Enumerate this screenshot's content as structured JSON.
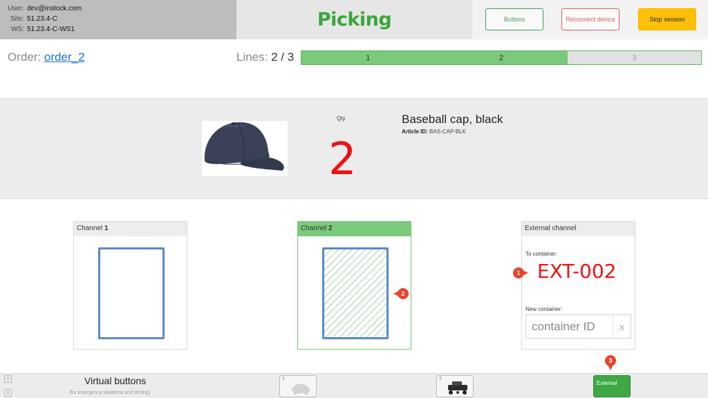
{
  "header": {
    "user_label": "User:",
    "user_value": "dev@instock.com",
    "site_label": "Site:",
    "site_value": "51.23.4-C",
    "ws_label": "WS:",
    "ws_value": "51.23.4-C-WS1",
    "title": "Picking",
    "buttons_label": "Buttons",
    "reconnect_label": "Reconnect device",
    "stop_label": "Stop session"
  },
  "order": {
    "label": "Order:",
    "value": "order_2"
  },
  "lines": {
    "label": "Lines:",
    "count": "2 / 3",
    "segments": [
      {
        "label": "1",
        "state": "done"
      },
      {
        "label": "2",
        "state": "done"
      },
      {
        "label": "3",
        "state": "todo"
      }
    ]
  },
  "article": {
    "image_icon": "baseball-cap-image",
    "qty_label": "Qty",
    "qty_value": "2",
    "name": "Baseball cap, black",
    "id_label": "Article ID:",
    "id_value": "BAS-CAP-BLK"
  },
  "channels": {
    "ch1_label": "Channel",
    "ch1_num": "1",
    "ch2_label": "Channel",
    "ch2_num": "2",
    "ext_label": "External channel",
    "to_container_label": "To container:",
    "to_container_value": "EXT-002",
    "new_container_label": "New container:",
    "new_container_placeholder": "container ID",
    "clear_label": "x",
    "pin1": "1",
    "pin2": "2",
    "pin3": "3"
  },
  "bottom": {
    "title": "Virtual buttons",
    "subtitle": "(for emergency situations and testing)",
    "box_a": "0",
    "box_b": "0",
    "btn1_num": "1",
    "btn2_num": "2",
    "ext_button_label": "External"
  },
  "colors": {
    "accent_green": "#3aa63a",
    "progress_done": "#7bc97b",
    "qty_red": "#ee1111",
    "slot_blue": "#5b87c8",
    "pin_red": "#e8452c",
    "stop_yellow": "#ffc107"
  }
}
